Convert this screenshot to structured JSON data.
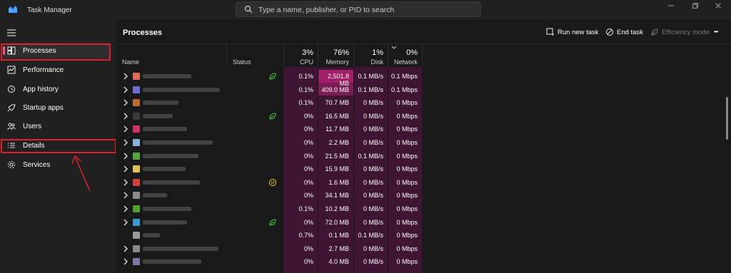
{
  "window": {
    "title": "Task Manager",
    "search_placeholder": "Type a name, publisher, or PID to search"
  },
  "sidebar": {
    "items": [
      {
        "label": "Processes",
        "icon": "processes-icon",
        "active": true
      },
      {
        "label": "Performance",
        "icon": "performance-icon"
      },
      {
        "label": "App history",
        "icon": "app-history-icon"
      },
      {
        "label": "Startup apps",
        "icon": "startup-apps-icon"
      },
      {
        "label": "Users",
        "icon": "users-icon"
      },
      {
        "label": "Details",
        "icon": "details-icon"
      },
      {
        "label": "Services",
        "icon": "services-icon"
      }
    ]
  },
  "toolbar": {
    "page_title": "Processes",
    "run_new_task": "Run new task",
    "end_task": "End task",
    "efficiency_mode": "Efficiency mode",
    "more": "•••"
  },
  "columns": {
    "name": "Name",
    "status": "Status",
    "cpu": {
      "pct": "3%",
      "label": "CPU"
    },
    "memory": {
      "pct": "76%",
      "label": "Memory"
    },
    "disk": {
      "pct": "1%",
      "label": "Disk"
    },
    "network": {
      "pct": "0%",
      "label": "Network"
    }
  },
  "rows": [
    {
      "cpu": "0.1%",
      "memory": "2,501.8 MB",
      "disk": "0.1 MB/s",
      "network": "0.1 Mbps"
    },
    {
      "cpu": "0.1%",
      "memory": "409.0 MB",
      "disk": "0.1 MB/s",
      "network": "0.1 Mbps"
    },
    {
      "cpu": "0.1%",
      "memory": "70.7 MB",
      "disk": "0 MB/s",
      "network": "0 Mbps"
    },
    {
      "cpu": "0%",
      "memory": "16.5 MB",
      "disk": "0 MB/s",
      "network": "0 Mbps"
    },
    {
      "cpu": "0%",
      "memory": "11.7 MB",
      "disk": "0 MB/s",
      "network": "0 Mbps"
    },
    {
      "cpu": "0%",
      "memory": "2.2 MB",
      "disk": "0 MB/s",
      "network": "0 Mbps"
    },
    {
      "cpu": "0%",
      "memory": "21.5 MB",
      "disk": "0.1 MB/s",
      "network": "0 Mbps"
    },
    {
      "cpu": "0%",
      "memory": "15.9 MB",
      "disk": "0 MB/s",
      "network": "0 Mbps"
    },
    {
      "cpu": "0%",
      "memory": "1.6 MB",
      "disk": "0 MB/s",
      "network": "0 Mbps"
    },
    {
      "cpu": "0%",
      "memory": "34.1 MB",
      "disk": "0 MB/s",
      "network": "0 Mbps"
    },
    {
      "cpu": "0.1%",
      "memory": "10.2 MB",
      "disk": "0 MB/s",
      "network": "0 Mbps"
    },
    {
      "cpu": "0%",
      "memory": "72.0 MB",
      "disk": "0 MB/s",
      "network": "0 Mbps"
    },
    {
      "cpu": "0.7%",
      "memory": "0.1 MB",
      "disk": "0.1 MB/s",
      "network": "0 Mbps"
    },
    {
      "cpu": "0%",
      "memory": "2.7 MB",
      "disk": "0 MB/s",
      "network": "0 Mbps"
    },
    {
      "cpu": "0%",
      "memory": "4.0 MB",
      "disk": "0 MB/s",
      "network": "0 Mbps"
    }
  ],
  "colors": {
    "heat_base": "#3e1533",
    "heat_high": "#a11e68",
    "active_pill": "#e0609a",
    "annotation_red": "#e0202a"
  }
}
